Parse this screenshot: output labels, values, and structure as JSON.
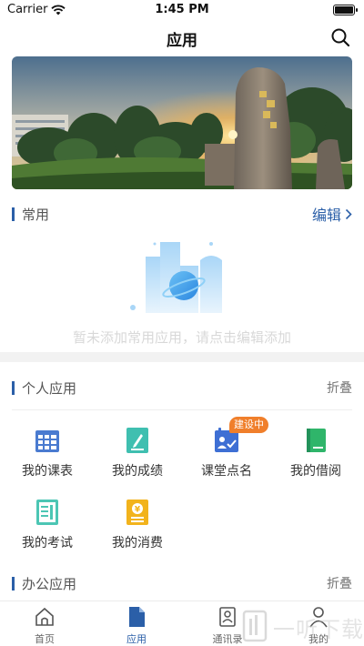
{
  "status_bar": {
    "carrier": "Carrier",
    "time": "1:45 PM"
  },
  "nav": {
    "title": "应用"
  },
  "common": {
    "title": "常用",
    "edit_label": "编辑",
    "empty_text": "暂未添加常用应用，请点击编辑添加"
  },
  "personal": {
    "title": "个人应用",
    "collapse_label": "折叠",
    "apps": [
      {
        "label": "我的课表",
        "icon": "calendar-icon",
        "color": "#4a7bd0"
      },
      {
        "label": "我的成绩",
        "icon": "score-icon",
        "color": "#3fbfb0"
      },
      {
        "label": "课堂点名",
        "icon": "attendance-icon",
        "color": "#3e6fd4",
        "badge": "建设中"
      },
      {
        "label": "我的借阅",
        "icon": "book-icon",
        "color": "#2fb56a"
      },
      {
        "label": "我的考试",
        "icon": "exam-icon",
        "color": "#4cc6b4"
      },
      {
        "label": "我的消费",
        "icon": "wallet-icon",
        "color": "#f2b31c"
      }
    ]
  },
  "office": {
    "title": "办公应用",
    "collapse_label": "折叠"
  },
  "tabs": [
    {
      "label": "首页",
      "icon": "home-icon"
    },
    {
      "label": "应用",
      "icon": "app-doc-icon",
      "active": true
    },
    {
      "label": "通讯录",
      "icon": "contacts-icon"
    },
    {
      "label": "我的",
      "icon": "profile-icon"
    }
  ],
  "watermark": {
    "text": "一听下载"
  },
  "colors": {
    "accent": "#2b5fa8",
    "badge": "#f07f2b"
  }
}
